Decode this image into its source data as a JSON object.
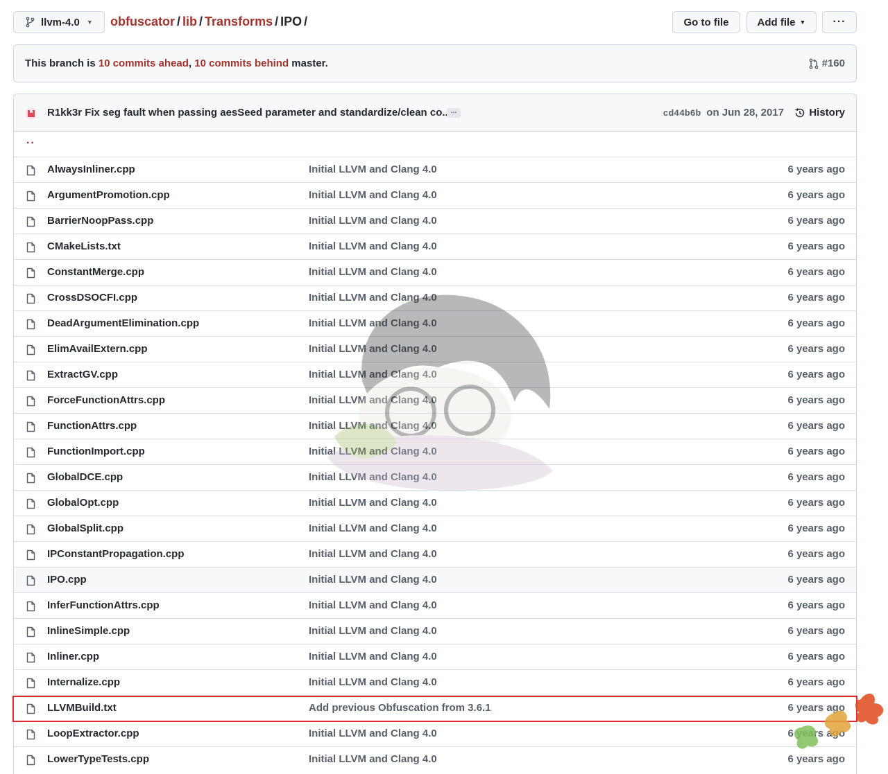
{
  "topbar": {
    "branch": "llvm-4.0",
    "breadcrumb": [
      {
        "label": "obfuscator"
      },
      {
        "label": "lib"
      },
      {
        "label": "Transforms"
      }
    ],
    "current": "IPO",
    "go_to_file": "Go to file",
    "add_file": "Add file",
    "more": "···"
  },
  "banner": {
    "prefix": "This branch is ",
    "ahead": "10 commits ahead",
    "comma": ", ",
    "behind": "10 commits behind",
    "suffix": " master.",
    "pr": "#160"
  },
  "commit": {
    "message": "R1kk3r Fix seg fault when passing aesSeed parameter and standardize/clean co...",
    "ellipsis": "...",
    "sha": "cd44b6b",
    "date": "on Jun 28, 2017",
    "history": "History"
  },
  "parent_dir": "..",
  "files": [
    {
      "name": "AlwaysInliner.cpp",
      "message": "Initial LLVM and Clang 4.0",
      "age": "6 years ago"
    },
    {
      "name": "ArgumentPromotion.cpp",
      "message": "Initial LLVM and Clang 4.0",
      "age": "6 years ago"
    },
    {
      "name": "BarrierNoopPass.cpp",
      "message": "Initial LLVM and Clang 4.0",
      "age": "6 years ago"
    },
    {
      "name": "CMakeLists.txt",
      "message": "Initial LLVM and Clang 4.0",
      "age": "6 years ago"
    },
    {
      "name": "ConstantMerge.cpp",
      "message": "Initial LLVM and Clang 4.0",
      "age": "6 years ago"
    },
    {
      "name": "CrossDSOCFI.cpp",
      "message": "Initial LLVM and Clang 4.0",
      "age": "6 years ago"
    },
    {
      "name": "DeadArgumentElimination.cpp",
      "message": "Initial LLVM and Clang 4.0",
      "age": "6 years ago"
    },
    {
      "name": "ElimAvailExtern.cpp",
      "message": "Initial LLVM and Clang 4.0",
      "age": "6 years ago"
    },
    {
      "name": "ExtractGV.cpp",
      "message": "Initial LLVM and Clang 4.0",
      "age": "6 years ago"
    },
    {
      "name": "ForceFunctionAttrs.cpp",
      "message": "Initial LLVM and Clang 4.0",
      "age": "6 years ago"
    },
    {
      "name": "FunctionAttrs.cpp",
      "message": "Initial LLVM and Clang 4.0",
      "age": "6 years ago"
    },
    {
      "name": "FunctionImport.cpp",
      "message": "Initial LLVM and Clang 4.0",
      "age": "6 years ago"
    },
    {
      "name": "GlobalDCE.cpp",
      "message": "Initial LLVM and Clang 4.0",
      "age": "6 years ago"
    },
    {
      "name": "GlobalOpt.cpp",
      "message": "Initial LLVM and Clang 4.0",
      "age": "6 years ago"
    },
    {
      "name": "GlobalSplit.cpp",
      "message": "Initial LLVM and Clang 4.0",
      "age": "6 years ago"
    },
    {
      "name": "IPConstantPropagation.cpp",
      "message": "Initial LLVM and Clang 4.0",
      "age": "6 years ago"
    },
    {
      "name": "IPO.cpp",
      "message": "Initial LLVM and Clang 4.0",
      "age": "6 years ago",
      "hovered": true
    },
    {
      "name": "InferFunctionAttrs.cpp",
      "message": "Initial LLVM and Clang 4.0",
      "age": "6 years ago"
    },
    {
      "name": "InlineSimple.cpp",
      "message": "Initial LLVM and Clang 4.0",
      "age": "6 years ago"
    },
    {
      "name": "Inliner.cpp",
      "message": "Initial LLVM and Clang 4.0",
      "age": "6 years ago"
    },
    {
      "name": "Internalize.cpp",
      "message": "Initial LLVM and Clang 4.0",
      "age": "6 years ago"
    },
    {
      "name": "LLVMBuild.txt",
      "message": "Add previous Obfuscation from 3.6.1",
      "age": "6 years ago",
      "highlighted": true
    },
    {
      "name": "LoopExtractor.cpp",
      "message": "Initial LLVM and Clang 4.0",
      "age": "6 years ago"
    },
    {
      "name": "LowerTypeTests.cpp",
      "message": "Initial LLVM and Clang 4.0",
      "age": "6 years ago"
    }
  ],
  "colors": {
    "link": "#a2332d",
    "highlight_border": "#e0282e",
    "muted_text": "#57606a",
    "border": "#d0d7de"
  }
}
